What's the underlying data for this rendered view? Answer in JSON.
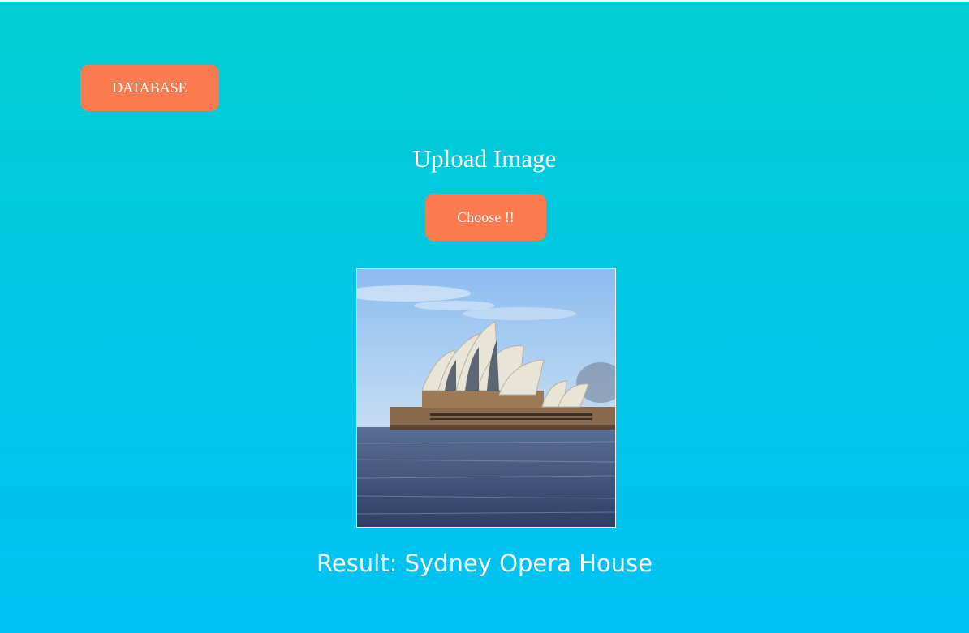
{
  "header": {
    "database_button_label": "DATABASE"
  },
  "upload": {
    "title": "Upload Image",
    "choose_button_label": "Choose !!"
  },
  "preview": {
    "subject": "Sydney Opera House photo",
    "alt": "Sydney Opera House"
  },
  "result": {
    "text": "Result: Sydney Opera House"
  },
  "colors": {
    "button": "#fa7b4f",
    "background_top": "#00cdd2",
    "background_bottom": "#00c2f5",
    "text": "#ffffff"
  }
}
